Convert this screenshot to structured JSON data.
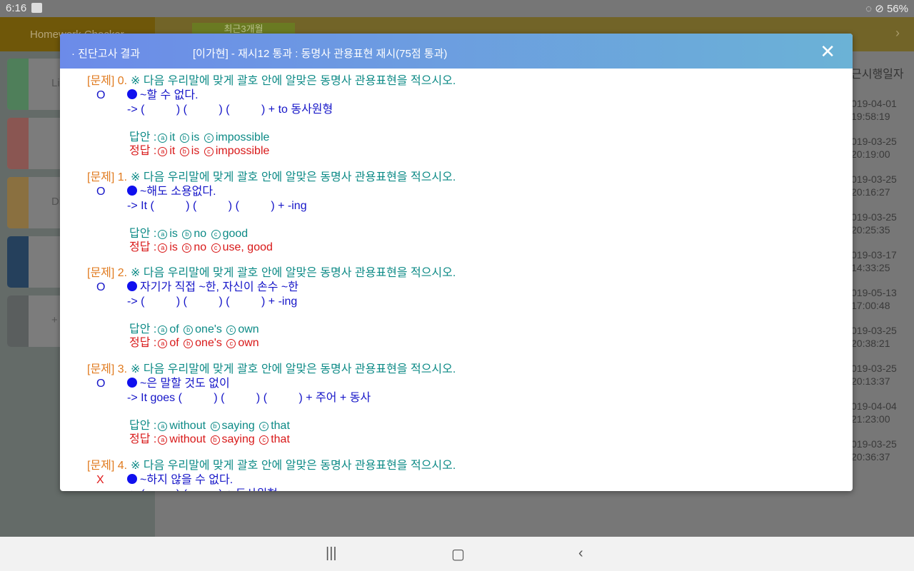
{
  "status_bar": {
    "time": "6:16",
    "battery": "56%"
  },
  "app_bar": {
    "home_label": "Homework Checker",
    "tab_label": "최근3개월"
  },
  "left_tiles": [
    {
      "label": "Li",
      "color": "#4f7f5a"
    },
    {
      "label": "",
      "color": "#8a5652"
    },
    {
      "label": "Di",
      "color": "#8a7040"
    },
    {
      "label": "",
      "color": "#25405c"
    },
    {
      "label": "+",
      "color": "#5a5e5e"
    }
  ],
  "right_list": {
    "header": "근시행일자",
    "dates": [
      [
        "019-04-01",
        "19:58:19"
      ],
      [
        "019-03-25",
        "20:19:00"
      ],
      [
        "019-03-25",
        "20:16:27"
      ],
      [
        "019-03-25",
        "20:25:35"
      ],
      [
        "019-03-17",
        "14:33:25"
      ],
      [
        "019-05-13",
        "17:00:48"
      ],
      [
        "019-03-25",
        "20:38:21"
      ],
      [
        "019-03-25",
        "20:13:37"
      ],
      [
        "019-04-04",
        "21:23:00"
      ],
      [
        "019-03-25",
        "20:36:37"
      ]
    ]
  },
  "modal": {
    "title": "· 진단고사 결과",
    "subtitle": "[이가현] - 재시12 통과 : 동명사 관용표현 재시(75점 통과)",
    "answer_label": "답안 :",
    "correct_label": "정답 :",
    "questions": [
      {
        "num": "[문제] 0.",
        "instruction": "※ 다음 우리말에 맞게 괄호 안에 알맞은 동명사 관용표현을 적으시오.",
        "result": "O",
        "prompt": "~할 수 없다.",
        "pattern": "-> (          ) (          ) (          ) + to 동사원형",
        "answer": [
          "it",
          "is",
          "impossible"
        ],
        "correct": [
          "it",
          "is",
          "impossible"
        ]
      },
      {
        "num": "[문제] 1.",
        "instruction": "※ 다음 우리말에 맞게 괄호 안에 알맞은 동명사 관용표현을 적으시오.",
        "result": "O",
        "prompt": "~해도 소용없다.",
        "pattern": "-> It (          ) (          ) (          ) + -ing",
        "answer": [
          "is",
          "no",
          "good"
        ],
        "correct": [
          "is",
          "no",
          "use, good"
        ]
      },
      {
        "num": "[문제] 2.",
        "instruction": "※ 다음 우리말에 맞게 괄호 안에 알맞은 동명사 관용표현을 적으시오.",
        "result": "O",
        "prompt": "자기가 직접 ~한, 자신이 손수 ~한",
        "pattern": "-> (          ) (          ) (          ) + -ing",
        "answer": [
          "of",
          "one's",
          "own"
        ],
        "correct": [
          "of",
          "one's",
          "own"
        ]
      },
      {
        "num": "[문제] 3.",
        "instruction": "※ 다음 우리말에 맞게 괄호 안에 알맞은 동명사 관용표현을 적으시오.",
        "result": "O",
        "prompt": "~은 말할 것도 없이",
        "pattern": "-> It goes (          ) (          ) (          ) + 주어 + 동사",
        "answer": [
          "without",
          "saying",
          "that"
        ],
        "correct": [
          "without",
          "saying",
          "that"
        ]
      },
      {
        "num": "[문제] 4.",
        "instruction": "※ 다음 우리말에 맞게 괄호 안에 알맞은 동명사 관용표현을 적으시오.",
        "result": "X",
        "prompt": "~하지 않을 수 없다.",
        "pattern": "-> (          ) (          ) + 동사원형",
        "answer": [],
        "correct": []
      }
    ]
  },
  "colors": {
    "header_start": "#6c8be9",
    "header_end": "#6bb2d6",
    "number": "#e07a1e",
    "instruction": "#0c8a86",
    "prompt": "#1515c8",
    "wrong": "#e01a1a",
    "correct": "#d81818"
  }
}
